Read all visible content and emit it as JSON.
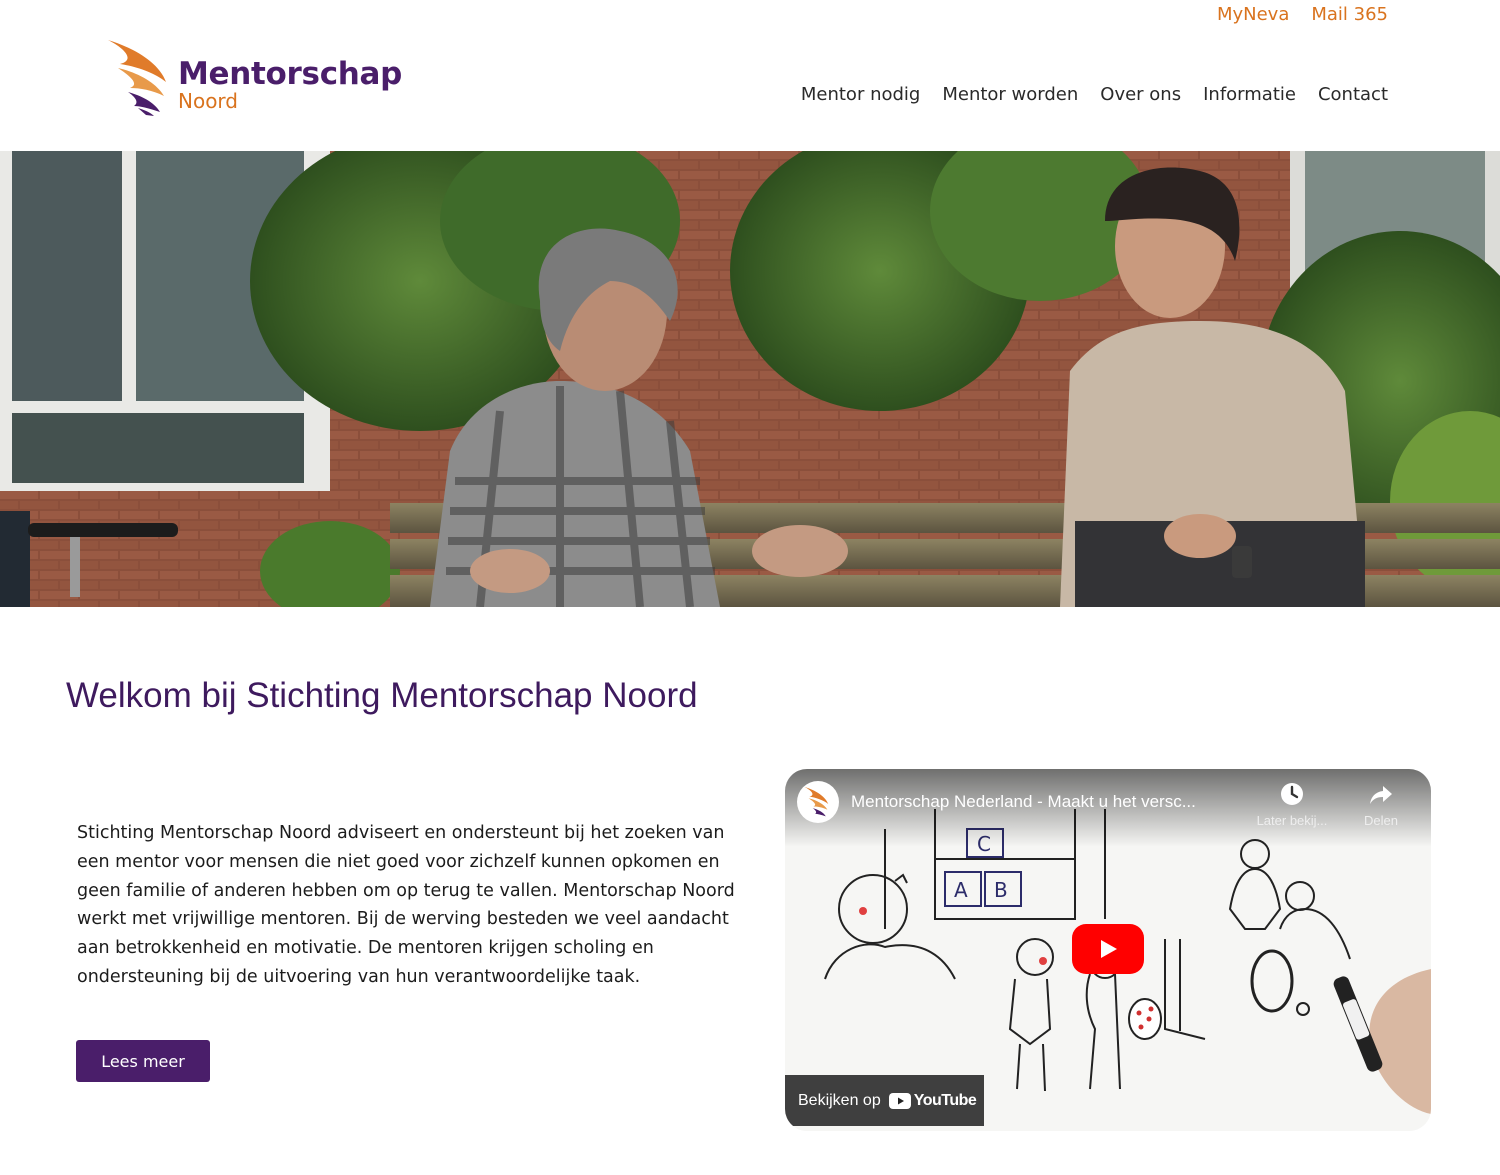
{
  "header": {
    "top_links": [
      {
        "label": "MyNeva"
      },
      {
        "label": "Mail 365"
      }
    ],
    "logo": {
      "title": "Mentorschap",
      "subtitle": "Noord"
    },
    "nav": [
      {
        "label": "Mentor nodig"
      },
      {
        "label": "Mentor worden"
      },
      {
        "label": "Over ons"
      },
      {
        "label": "Informatie"
      },
      {
        "label": "Contact"
      }
    ]
  },
  "main": {
    "title": "Welkom bij Stichting Mentorschap Noord",
    "intro": "Stichting Mentorschap Noord adviseert en ondersteunt bij het zoeken van een mentor voor mensen die niet goed voor zichzelf kunnen opkomen en geen familie of anderen hebben om op terug te vallen. Mentorschap Noord werkt met vrijwillige mentoren. Bij de werving besteden we veel aandacht aan betrokkenheid en motivatie. De mentoren krijgen scholing en ondersteuning bij de uitvoering van hun verantwoordelijke taak.",
    "read_more_label": "Lees meer"
  },
  "video": {
    "title": "Mentorschap Nederland - Maakt u het versc...",
    "watch_later_label": "Later bekij...",
    "share_label": "Delen",
    "watch_on_label": "Bekijken op",
    "youtube_wordmark": "YouTube",
    "sketch_letters": [
      "C",
      "A",
      "B"
    ]
  },
  "colors": {
    "brand_purple": "#4a1e6a",
    "brand_orange": "#d9731e",
    "youtube_red": "#ff0000"
  }
}
